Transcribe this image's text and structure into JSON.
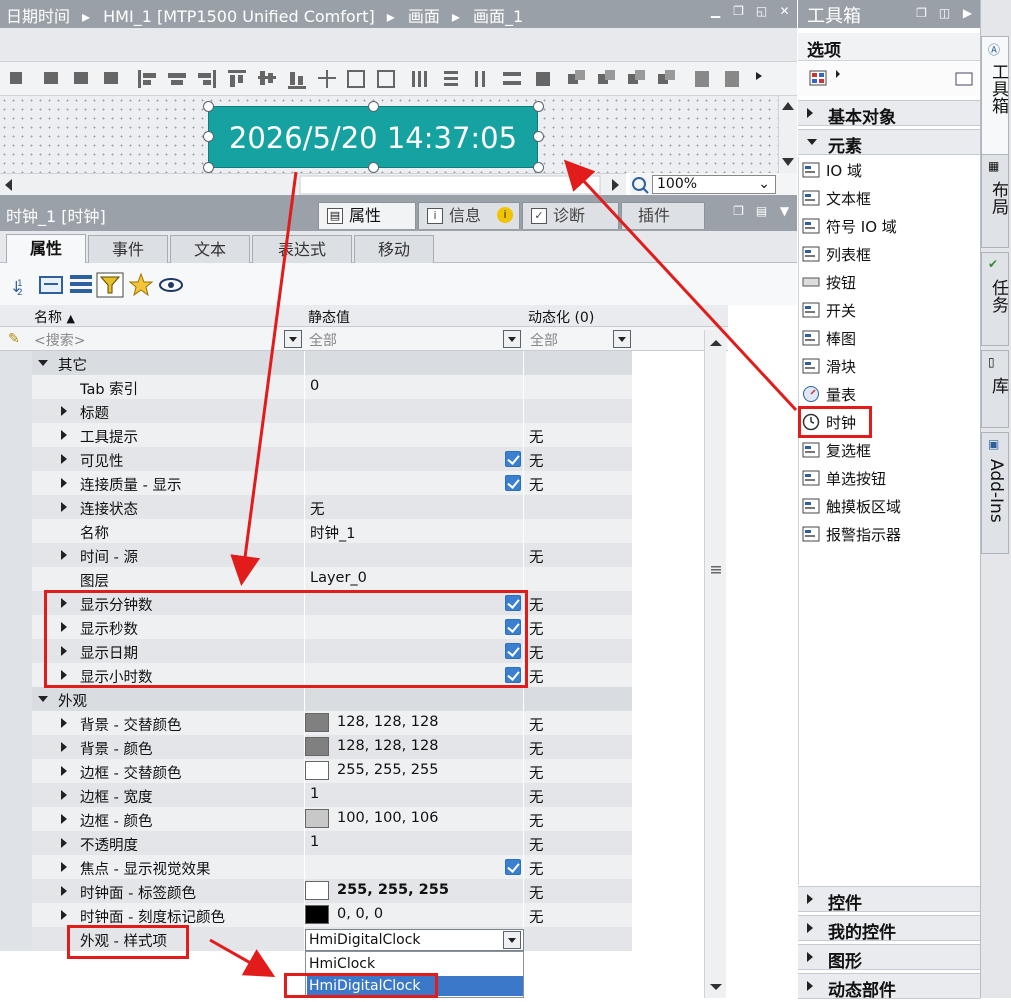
{
  "editor": {
    "breadcrumb": [
      "日期时间",
      "HMI_1 [MTP1500 Unified Comfort]",
      "画面",
      "画面_1"
    ],
    "clock_text": "2026/5/20 14:37:05",
    "zoom": "100%"
  },
  "inspector": {
    "title": "时钟_1 [时钟]",
    "tabs": [
      "属性",
      "信息",
      "诊断",
      "插件"
    ],
    "subtabs": [
      "属性",
      "事件",
      "文本",
      "表达式",
      "移动"
    ],
    "columns": {
      "name": "名称",
      "static": "静态值",
      "dynamic": "动态化 (0)"
    },
    "filters": {
      "name": "<搜索>",
      "static": "全部",
      "dynamic": "全部"
    },
    "rows": [
      {
        "label": "其它",
        "group": true
      },
      {
        "label": "Tab 索引",
        "static": "0",
        "dyn": ""
      },
      {
        "label": "标题",
        "expand": true,
        "static": "",
        "dyn": ""
      },
      {
        "label": "工具提示",
        "expand": true,
        "static": "",
        "dyn": "无"
      },
      {
        "label": "可见性",
        "expand": true,
        "check": true,
        "dyn": "无"
      },
      {
        "label": "连接质量 - 显示",
        "expand": true,
        "check": true,
        "dyn": "无"
      },
      {
        "label": "连接状态",
        "expand": true,
        "static": "无",
        "dyn": ""
      },
      {
        "label": "名称",
        "static": "时钟_1",
        "dyn": ""
      },
      {
        "label": "时间 - 源",
        "expand": true,
        "static": "",
        "dyn": "无"
      },
      {
        "label": "图层",
        "static": "Layer_0",
        "dyn": ""
      },
      {
        "label": "显示分钟数",
        "expand": true,
        "check": true,
        "dyn": "无"
      },
      {
        "label": "显示秒数",
        "expand": true,
        "check": true,
        "dyn": "无"
      },
      {
        "label": "显示日期",
        "expand": true,
        "check": true,
        "dyn": "无"
      },
      {
        "label": "显示小时数",
        "expand": true,
        "check": true,
        "dyn": "无"
      },
      {
        "label": "外观",
        "group": true
      },
      {
        "label": "背景 - 交替颜色",
        "expand": true,
        "swatch": "#808080",
        "static": "128, 128, 128",
        "dyn": "无"
      },
      {
        "label": "背景 - 颜色",
        "expand": true,
        "swatch": "#808080",
        "static": "128, 128, 128",
        "dyn": "无"
      },
      {
        "label": "边框 - 交替颜色",
        "expand": true,
        "swatch": "#ffffff",
        "static": "255, 255, 255",
        "dyn": "无"
      },
      {
        "label": "边框 - 宽度",
        "expand": true,
        "static": "1",
        "dyn": "无"
      },
      {
        "label": "边框 - 颜色",
        "expand": true,
        "swatch": "#c8c8c8",
        "static": "100, 100, 106",
        "dyn": "无"
      },
      {
        "label": "不透明度",
        "expand": true,
        "static": "1",
        "dyn": "无"
      },
      {
        "label": "焦点 - 显示视觉效果",
        "expand": true,
        "check": true,
        "dyn": "无"
      },
      {
        "label": "时钟面 - 标签颜色",
        "expand": true,
        "swatch": "#ffffff",
        "static": "255, 255, 255",
        "bold": true,
        "dyn": "无"
      },
      {
        "label": "时钟面 - 刻度标记颜色",
        "expand": true,
        "swatch": "#000000",
        "static": "0, 0, 0",
        "dyn": "无"
      },
      {
        "label": "外观 - 样式项",
        "static": "",
        "dyn": ""
      }
    ],
    "style_select": "HmiDigitalClock",
    "style_options": [
      "HmiClock",
      "HmiDigitalClock"
    ]
  },
  "toolbox": {
    "title": "工具箱",
    "options": "选项",
    "basic": "基本对象",
    "elements": "元素",
    "items": [
      "IO 域",
      "文本框",
      "符号 IO 域",
      "列表框",
      "按钮",
      "开关",
      "棒图",
      "滑块",
      "量表",
      "时钟",
      "复选框",
      "单选按钮",
      "触摸板区域",
      "报警指示器"
    ],
    "bottom": [
      "控件",
      "我的控件",
      "图形",
      "动态部件"
    ],
    "vtabs": [
      "工具箱",
      "布局",
      "任务",
      "库",
      "Add-Ins"
    ]
  },
  "colors": {
    "clock_bg": "#16a2a0",
    "annotation": "#e21b1b",
    "checkbox": "#3a7fd0"
  }
}
